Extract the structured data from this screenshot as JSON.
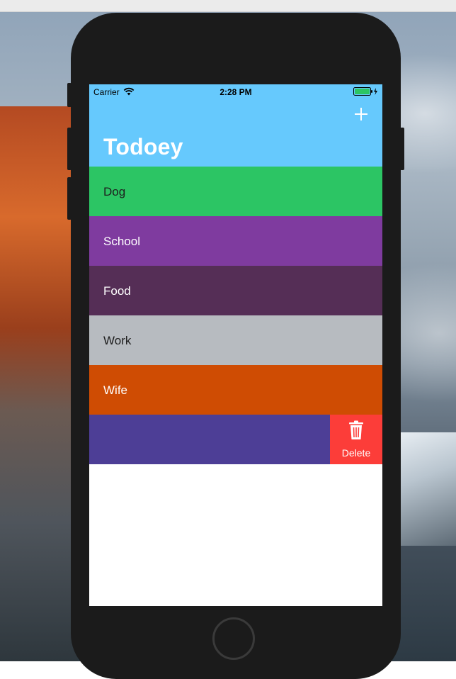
{
  "status_bar": {
    "carrier": "Carrier",
    "time": "2:28 PM",
    "wifi_icon": "wifi-icon",
    "battery_icon": "battery-charging-icon"
  },
  "navbar": {
    "title": "Todoey",
    "add_icon": "plus-icon",
    "background_color": "#66C9FD"
  },
  "categories": [
    {
      "name": "Dog",
      "color": "#2CC564",
      "text_color": "#1E1E1E"
    },
    {
      "name": "School",
      "color": "#7F3B9F",
      "text_color": "#FFFFFF"
    },
    {
      "name": "Food",
      "color": "#552E56",
      "text_color": "#FFFFFF"
    },
    {
      "name": "Work",
      "color": "#B7BBC0",
      "text_color": "#1E1E1E"
    },
    {
      "name": "Wife",
      "color": "#CF4C03",
      "text_color": "#FFFFFF"
    },
    {
      "name": "",
      "color": "#4D3E96",
      "text_color": "#FFFFFF",
      "swiped": true
    }
  ],
  "swipe_action": {
    "label": "Delete",
    "icon": "trash-icon",
    "color": "#FC3D39"
  }
}
